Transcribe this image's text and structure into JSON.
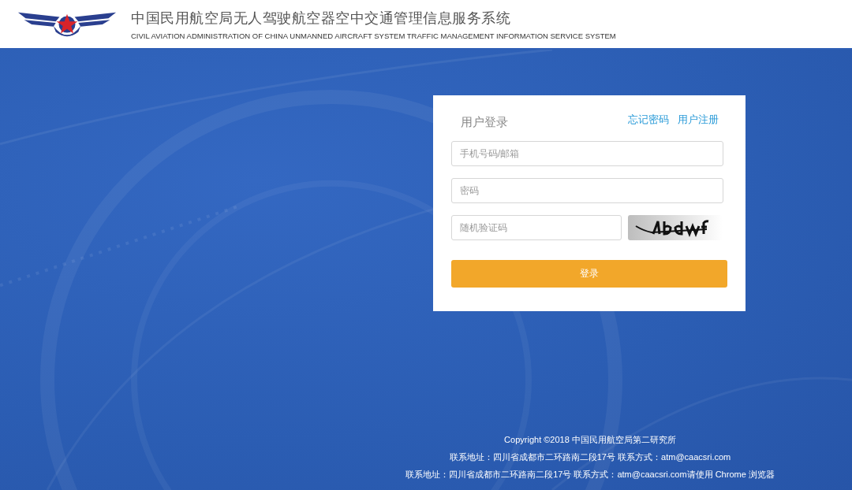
{
  "header": {
    "title": "中国民用航空局无人驾驶航空器空中交通管理信息服务系统",
    "subtitle": "CIVIL AVIATION ADMINISTRATION OF CHINA UNMANNED AIRCRAFT SYSTEM TRAFFIC MANAGEMENT INFORMATION SERVICE SYSTEM"
  },
  "login": {
    "title": "用户登录",
    "links": [
      "忘记密码",
      "用户注册"
    ],
    "fields": [
      {
        "placeholder": "手机号码/邮箱"
      },
      {
        "placeholder": "密码"
      }
    ],
    "captcha": {
      "placeholder": "随机验证码"
    },
    "button": "登录"
  },
  "footer": [
    "Copyright ©2018 中国民用航空局第二研究所",
    "联系地址：四川省成都市二环路南二段17号 联系方式：atm@caacsri.com",
    "联系地址：四川省成都市二环路南二段17号 联系方式：atm@caacsri.com请使用 Chrome 浏览器"
  ]
}
